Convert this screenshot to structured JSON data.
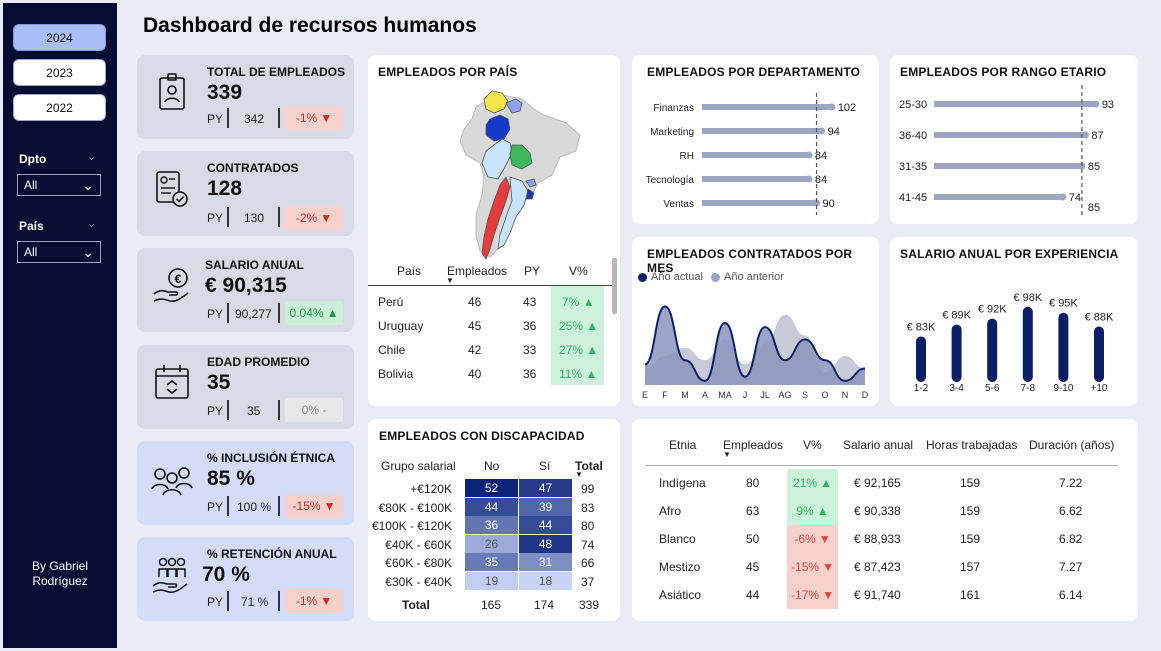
{
  "title": "Dashboard de recursos humanos",
  "years": [
    "2024",
    "2023",
    "2022"
  ],
  "active_year": "2024",
  "filters": {
    "dept_label": "Dpto",
    "dept_value": "All",
    "country_label": "País",
    "country_value": "All"
  },
  "byline": "By Gabriel Rodríguez",
  "kpis": [
    {
      "title": "TOTAL DE EMPLEADOS",
      "value": "339",
      "py_label": "PY",
      "py_value": "342",
      "delta": "-1%",
      "trend": "down"
    },
    {
      "title": "CONTRATADOS",
      "value": "128",
      "py_label": "PY",
      "py_value": "130",
      "delta": "-2%",
      "trend": "down"
    },
    {
      "title": "SALARIO ANUAL",
      "value": "€ 90,315",
      "py_label": "PY",
      "py_value": "90,277",
      "delta": "0.04%",
      "trend": "up"
    },
    {
      "title": "EDAD PROMEDIO",
      "value": "35",
      "py_label": "PY",
      "py_value": "35",
      "delta": "0% -",
      "trend": "flat"
    },
    {
      "title": "% INCLUSIÓN ÉTNICA",
      "value": "85 %",
      "py_label": "PY",
      "py_value": "100 %",
      "delta": "-15%",
      "trend": "down"
    },
    {
      "title": "% RETENCIÓN ANUAL",
      "value": "70 %",
      "py_label": "PY",
      "py_value": "71 %",
      "delta": "-1%",
      "trend": "down"
    }
  ],
  "country": {
    "title": "EMPLEADOS POR PAÍS",
    "headers": [
      "País",
      "Empleados",
      "PY",
      "V%"
    ],
    "rows": [
      [
        "Perú",
        "46",
        "43",
        "7%"
      ],
      [
        "Uruguay",
        "45",
        "36",
        "25%"
      ],
      [
        "Chile",
        "42",
        "33",
        "27%"
      ],
      [
        "Bolivia",
        "40",
        "36",
        "11%"
      ]
    ]
  },
  "dept": {
    "title": "EMPLEADOS POR DEPARTAMENTO"
  },
  "age": {
    "title": "EMPLEADOS POR RANGO ETARIO"
  },
  "monthly": {
    "title": "EMPLEADOS CONTRATADOS POR MES",
    "legend": [
      "Año actual",
      "Año anterior"
    ]
  },
  "exp": {
    "title": "SALARIO ANUAL POR EXPERIENCIA"
  },
  "disab": {
    "title": "EMPLEADOS CON DISCAPACIDAD",
    "headers": [
      "Grupo salarial",
      "No",
      "Sí",
      "Total"
    ],
    "rows": [
      [
        "+€120K",
        "52",
        "47",
        "99"
      ],
      [
        "€80K - €100K",
        "44",
        "39",
        "83"
      ],
      [
        "€100K - €120K",
        "36",
        "44",
        "80"
      ],
      [
        "€40K - €60K",
        "26",
        "48",
        "74"
      ],
      [
        "€60K - €80K",
        "35",
        "31",
        "66"
      ],
      [
        "€30K - €40K",
        "19",
        "18",
        "37"
      ]
    ],
    "total": [
      "Total",
      "165",
      "174",
      "339"
    ]
  },
  "eth": {
    "headers": [
      "Etnia",
      "Empleados",
      "V%",
      "Salario anual",
      "Horas trabajadas",
      "Duración (años)"
    ],
    "rows": [
      [
        "Indígena",
        "80",
        "21%",
        "€ 92,165",
        "159",
        "7.22"
      ],
      [
        "Afro",
        "63",
        "9%",
        "€ 90,338",
        "159",
        "6.62"
      ],
      [
        "Blanco",
        "50",
        "-6%",
        "€ 88,933",
        "159",
        "6.82"
      ],
      [
        "Mestizo",
        "45",
        "-15%",
        "€ 87,423",
        "157",
        "7.27"
      ],
      [
        "Asiático",
        "44",
        "-17%",
        "€ 91,740",
        "161",
        "6.14"
      ]
    ]
  },
  "chart_data": [
    {
      "type": "bar",
      "title": "EMPLEADOS POR DEPARTAMENTO",
      "categories": [
        "Finanzas",
        "Marketing",
        "RH",
        "Tecnología",
        "Ventas"
      ],
      "values": [
        102,
        94,
        84,
        84,
        90
      ],
      "reference_value": 90,
      "reference_label": "90",
      "xlim": [
        0,
        110
      ]
    },
    {
      "type": "bar",
      "title": "EMPLEADOS POR RANGO ETARIO",
      "categories": [
        "25-30",
        "36-40",
        "31-35",
        "41-45"
      ],
      "values": [
        93,
        87,
        85,
        74
      ],
      "reference_value": 85,
      "reference_label": "85",
      "xlim": [
        0,
        100
      ]
    },
    {
      "type": "area",
      "title": "EMPLEADOS CONTRATADOS POR MES",
      "categories": [
        "E",
        "F",
        "M",
        "A",
        "MA",
        "J",
        "JL",
        "AG",
        "S",
        "O",
        "N",
        "D"
      ],
      "series": [
        {
          "name": "Año actual",
          "color": "#8995bd",
          "values": [
            10,
            38,
            12,
            2,
            30,
            4,
            28,
            12,
            22,
            12,
            2,
            8
          ]
        },
        {
          "name": "Año anterior",
          "color": "#c8cbd7",
          "values": [
            8,
            14,
            18,
            12,
            22,
            10,
            20,
            34,
            24,
            6,
            14,
            8
          ]
        }
      ],
      "ylim": [
        0,
        45
      ]
    },
    {
      "type": "bar",
      "title": "SALARIO ANUAL POR EXPERIENCIA",
      "categories": [
        "1-2",
        "3-4",
        "5-6",
        "7-8",
        "9-10",
        "+10"
      ],
      "values": [
        83,
        89,
        92,
        98,
        95,
        88
      ],
      "labels": [
        "€ 83K",
        "€ 89K",
        "€ 92K",
        "€ 98K",
        "€ 95K",
        "€ 88K"
      ],
      "ylim": [
        0,
        110
      ]
    }
  ]
}
